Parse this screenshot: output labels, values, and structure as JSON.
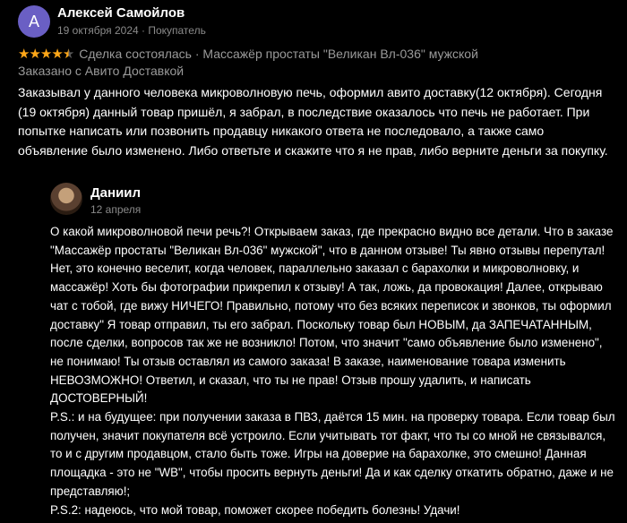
{
  "review": {
    "avatar_letter": "A",
    "avatar_color": "#6a5fc4",
    "author": "Алексей Самойлов",
    "meta": "19 октября 2024 · Покупатель",
    "rating": 4.5,
    "rating_max": 5,
    "star_color": "#ffa718",
    "deal_line": "Сделка состоялась · Массажёр простаты \"Великан Вл-036\" мужской",
    "delivery": "Заказано с Авито Доставкой",
    "text": "Заказывал у данного человека микроволновую печь, оформил авито доставку(12 октября). Сегодня (19 октября) данный товар пришёл, я забрал, в последствие оказалось что печь не работает. При попытке написать или позвонить продавцу никакого ответа не последовало, а также само объявление было изменено. Либо ответьте и скажите что я не прав, либо верните деньги за покупку."
  },
  "reply": {
    "author": "Даниил",
    "date": "12 апреля",
    "avatar_icon": "seller-photo-avatar",
    "paragraph_1": "О какой микроволновой печи речь?! Открываем заказ, где прекрасно видно все детали. Что в заказе \"Массажёр простаты \"Великан Вл-036\" мужской\", что в данном отзыве! Ты явно отзывы перепутал! Нет, это конечно веселит, когда человек, параллельно заказал с барахолки и микроволновку, и массажёр! Хоть бы фотографии прикрепил к отзыву! А так, ложь, да провокация! Далее, открываю чат с тобой, где вижу НИЧЕГО! Правильно, потому что без всяких переписок и звонков, ты оформил доставку\" Я товар отправил, ты его забрал. Поскольку товар был НОВЫМ, да ЗАПЕЧАТАННЫМ, после сделки, вопросов так же не возникло! Потом, что значит \"само объявление было изменено\", не понимаю! Ты отзыв оставлял из самого заказа! В заказе, наименование товара изменить НЕВОЗМОЖНО! Ответил, и сказал, что ты не прав! Отзыв прошу удалить, и написать ДОСТОВЕРНЫЙ!",
    "paragraph_2": "P.S.: и на будущее: при получении заказа в ПВЗ, даётся 15 мин. на проверку товара. Если товар был получен, значит покупателя всё устроило. Если учитывать тот факт, что ты со мной не связывался, то и с другим продавцом, стало быть тоже. Игры на доверие на барахолке, это смешно! Данная площадка - это не \"WB\", чтобы просить вернуть деньги! Да и как сделку откатить обратно, даже и не представляю!;",
    "paragraph_3": "P.S.2: надеюсь, что мой товар, поможет скорее победить болезнь! Удачи!"
  }
}
